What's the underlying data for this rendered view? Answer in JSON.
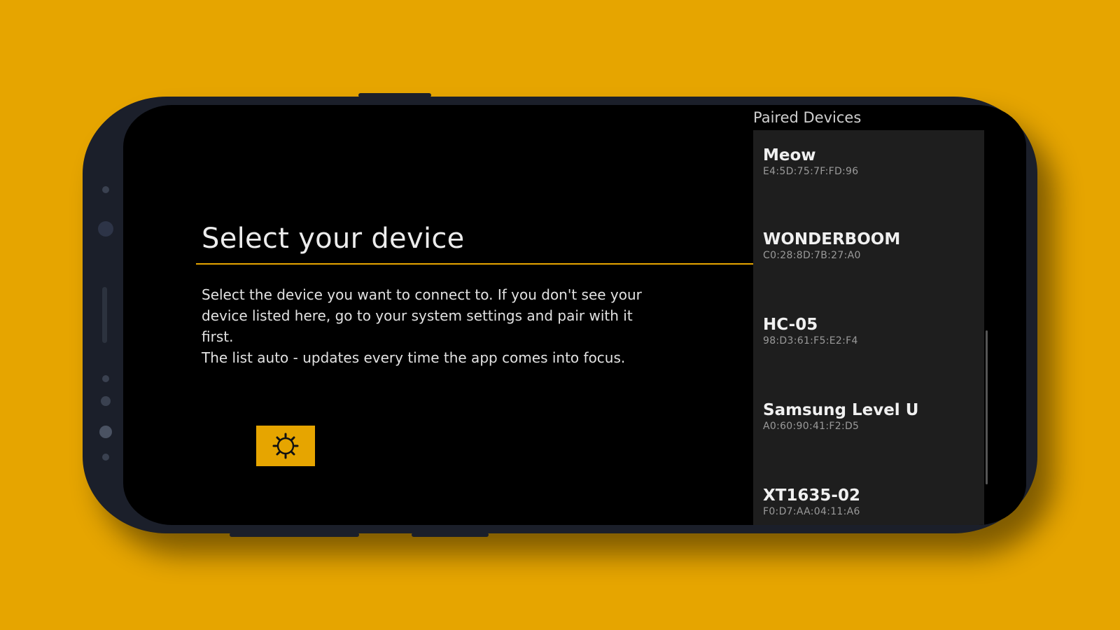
{
  "main": {
    "title": "Select your device",
    "description_line1": "Select the device you want to connect to. If you don't see your device listed here, go to your system settings and pair with it first.",
    "description_line2": "The list auto - updates every time the app comes into focus.",
    "settings_icon": "gear-icon"
  },
  "sidebar": {
    "header": "Paired Devices",
    "devices": [
      {
        "name": "Meow",
        "mac": "E4:5D:75:7F:FD:96"
      },
      {
        "name": "WONDERBOOM",
        "mac": "C0:28:8D:7B:27:A0"
      },
      {
        "name": "HC-05",
        "mac": "98:D3:61:F5:E2:F4"
      },
      {
        "name": "Samsung Level U",
        "mac": "A0:60:90:41:F2:D5"
      },
      {
        "name": "XT1635-02",
        "mac": "F0:D7:AA:04:11:A6"
      }
    ]
  },
  "colors": {
    "background": "#E6A500",
    "accent": "#E6A500",
    "screen": "#000000",
    "list_background": "#1E1E1E"
  }
}
